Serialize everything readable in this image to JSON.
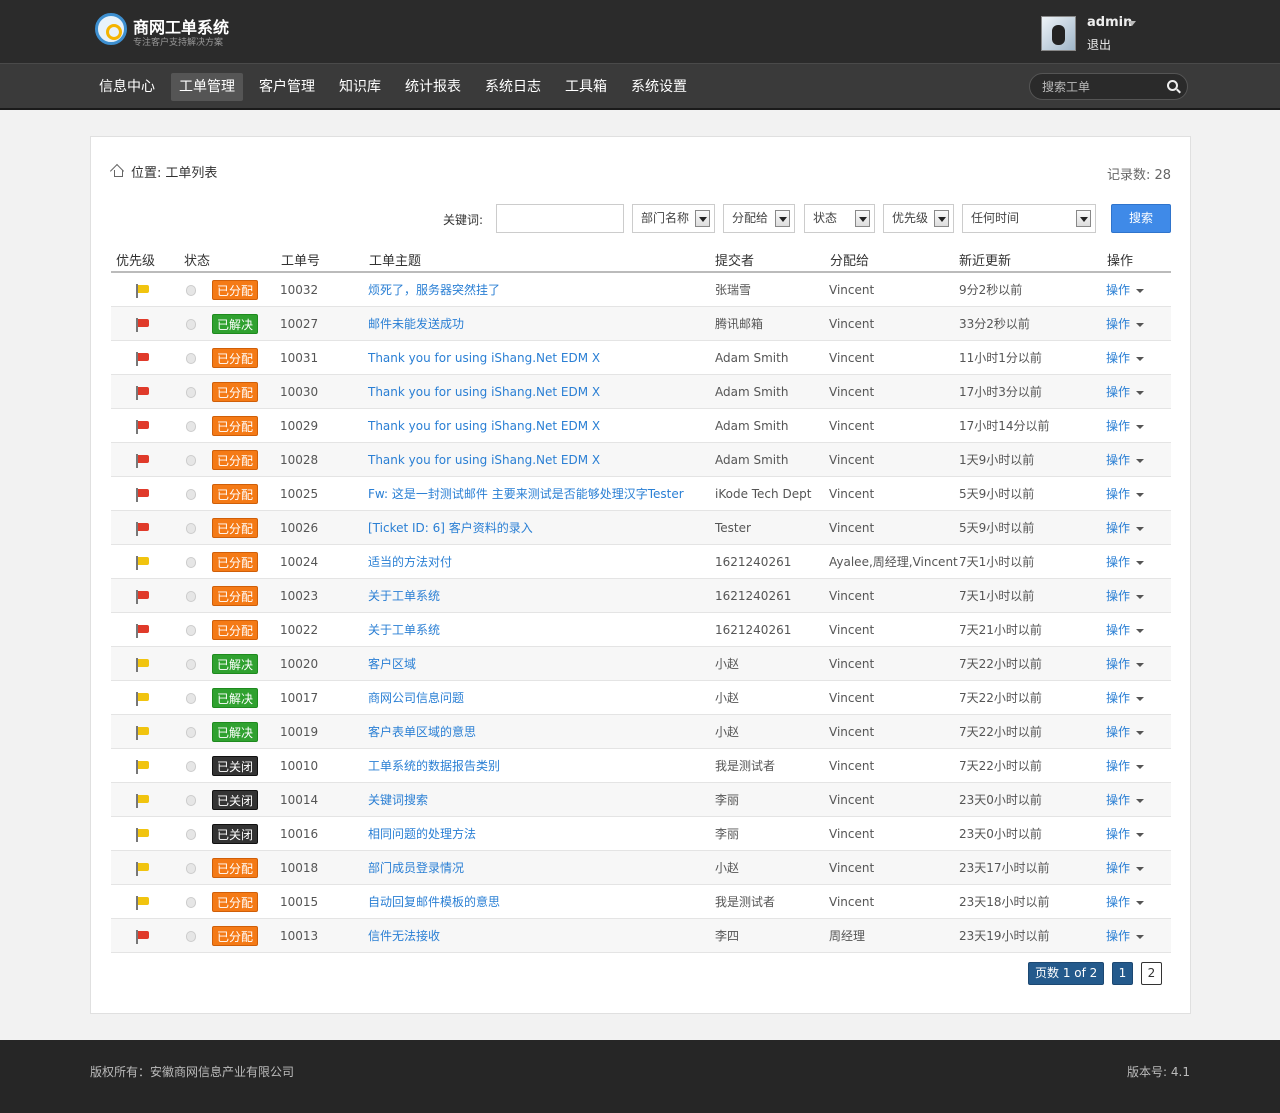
{
  "app": {
    "logo_title": "商网工单系统",
    "logo_subtitle": "专注客户支持解决方案",
    "user_name": "admin",
    "logout_label": "退出"
  },
  "nav": {
    "items": [
      "信息中心",
      "工单管理",
      "客户管理",
      "知识库",
      "统计报表",
      "系统日志",
      "工具箱",
      "系统设置"
    ],
    "active": "工单管理",
    "search_placeholder": "搜索工单"
  },
  "page": {
    "breadcrumb_prefix": "位置:",
    "breadcrumb_title": "工单列表",
    "record_count": "记录数: 28"
  },
  "filters": {
    "keyword_label": "关键词:",
    "keyword_value": "",
    "department": "部门名称",
    "assignee": "分配给",
    "status": "状态",
    "priority": "优先级",
    "time": "任何时间",
    "search_button": "搜索"
  },
  "table": {
    "headers": [
      "优先级",
      "状态",
      "工单号",
      "工单主题",
      "提交者",
      "分配给",
      "新近更新",
      "操作"
    ],
    "rows": [
      {
        "priority": "yellow",
        "status": "已分配",
        "status_type": "assigned",
        "id": "10032",
        "subject": "烦死了，服务器突然挂了",
        "submitter": "张瑞雪",
        "assignee": "Vincent",
        "updated": "9分2秒以前",
        "action": "操作"
      },
      {
        "priority": "red",
        "status": "已解决",
        "status_type": "resolved",
        "id": "10027",
        "subject": "邮件未能发送成功",
        "submitter": "腾讯邮箱",
        "assignee": "Vincent",
        "updated": "33分2秒以前",
        "action": "操作"
      },
      {
        "priority": "red",
        "status": "已分配",
        "status_type": "assigned",
        "id": "10031",
        "subject": "Thank you for using iShang.Net EDM X",
        "submitter": "Adam Smith",
        "assignee": "Vincent",
        "updated": "11小时1分以前",
        "action": "操作"
      },
      {
        "priority": "red",
        "status": "已分配",
        "status_type": "assigned",
        "id": "10030",
        "subject": "Thank you for using iShang.Net EDM X",
        "submitter": "Adam Smith",
        "assignee": "Vincent",
        "updated": "17小时3分以前",
        "action": "操作"
      },
      {
        "priority": "red",
        "status": "已分配",
        "status_type": "assigned",
        "id": "10029",
        "subject": "Thank you for using iShang.Net EDM X",
        "submitter": "Adam Smith",
        "assignee": "Vincent",
        "updated": "17小时14分以前",
        "action": "操作"
      },
      {
        "priority": "red",
        "status": "已分配",
        "status_type": "assigned",
        "id": "10028",
        "subject": "Thank you for using iShang.Net EDM X",
        "submitter": "Adam Smith",
        "assignee": "Vincent",
        "updated": "1天9小时以前",
        "action": "操作"
      },
      {
        "priority": "red",
        "status": "已分配",
        "status_type": "assigned",
        "id": "10025",
        "subject": "Fw: 这是一封测试邮件 主要来测试是否能够处理汉字Tester",
        "submitter": "iKode Tech Dept",
        "assignee": "Vincent",
        "updated": "5天9小时以前",
        "action": "操作"
      },
      {
        "priority": "red",
        "status": "已分配",
        "status_type": "assigned",
        "id": "10026",
        "subject": "[Ticket ID: 6] 客户资料的录入",
        "submitter": "Tester",
        "assignee": "Vincent",
        "updated": "5天9小时以前",
        "action": "操作"
      },
      {
        "priority": "yellow",
        "status": "已分配",
        "status_type": "assigned",
        "id": "10024",
        "subject": "适当的方法对付",
        "submitter": "1621240261",
        "assignee": "Ayalee,周经理,Vincent",
        "updated": "7天1小时以前",
        "action": "操作"
      },
      {
        "priority": "red",
        "status": "已分配",
        "status_type": "assigned",
        "id": "10023",
        "subject": "关于工单系统",
        "submitter": "1621240261",
        "assignee": "Vincent",
        "updated": "7天1小时以前",
        "action": "操作"
      },
      {
        "priority": "red",
        "status": "已分配",
        "status_type": "assigned",
        "id": "10022",
        "subject": "关于工单系统",
        "submitter": "1621240261",
        "assignee": "Vincent",
        "updated": "7天21小时以前",
        "action": "操作"
      },
      {
        "priority": "yellow",
        "status": "已解决",
        "status_type": "resolved",
        "id": "10020",
        "subject": "客户区域",
        "submitter": "小赵",
        "assignee": "Vincent",
        "updated": "7天22小时以前",
        "action": "操作"
      },
      {
        "priority": "yellow",
        "status": "已解决",
        "status_type": "resolved",
        "id": "10017",
        "subject": "商网公司信息问题",
        "submitter": "小赵",
        "assignee": "Vincent",
        "updated": "7天22小时以前",
        "action": "操作"
      },
      {
        "priority": "yellow",
        "status": "已解决",
        "status_type": "resolved",
        "id": "10019",
        "subject": "客户表单区域的意思",
        "submitter": "小赵",
        "assignee": "Vincent",
        "updated": "7天22小时以前",
        "action": "操作"
      },
      {
        "priority": "yellow",
        "status": "已关闭",
        "status_type": "closed",
        "id": "10010",
        "subject": "工单系统的数据报告类别",
        "submitter": "我是测试者",
        "assignee": "Vincent",
        "updated": "7天22小时以前",
        "action": "操作"
      },
      {
        "priority": "yellow",
        "status": "已关闭",
        "status_type": "closed",
        "id": "10014",
        "subject": "关键词搜索",
        "submitter": "李丽",
        "assignee": "Vincent",
        "updated": "23天0小时以前",
        "action": "操作"
      },
      {
        "priority": "yellow",
        "status": "已关闭",
        "status_type": "closed",
        "id": "10016",
        "subject": "相同问题的处理方法",
        "submitter": "李丽",
        "assignee": "Vincent",
        "updated": "23天0小时以前",
        "action": "操作"
      },
      {
        "priority": "yellow",
        "status": "已分配",
        "status_type": "assigned",
        "id": "10018",
        "subject": "部门成员登录情况",
        "submitter": "小赵",
        "assignee": "Vincent",
        "updated": "23天17小时以前",
        "action": "操作"
      },
      {
        "priority": "yellow",
        "status": "已分配",
        "status_type": "assigned",
        "id": "10015",
        "subject": "自动回复邮件模板的意思",
        "submitter": "我是测试者",
        "assignee": "Vincent",
        "updated": "23天18小时以前",
        "action": "操作"
      },
      {
        "priority": "red",
        "status": "已分配",
        "status_type": "assigned",
        "id": "10013",
        "subject": "信件无法接收",
        "submitter": "李四",
        "assignee": "周经理",
        "updated": "23天19小时以前",
        "action": "操作"
      }
    ]
  },
  "pagination": {
    "info": "页数 1 of 2",
    "pages": [
      "1",
      "2"
    ],
    "current": "1"
  },
  "footer": {
    "copyright": "版权所有：安徽商网信息产业有限公司",
    "version": "版本号: 4.1"
  },
  "colors": {
    "assigned": "#f47a16",
    "resolved": "#2fa12f",
    "closed": "#333333",
    "link": "#2a7fd4",
    "primary_button": "#3f8ae8"
  }
}
